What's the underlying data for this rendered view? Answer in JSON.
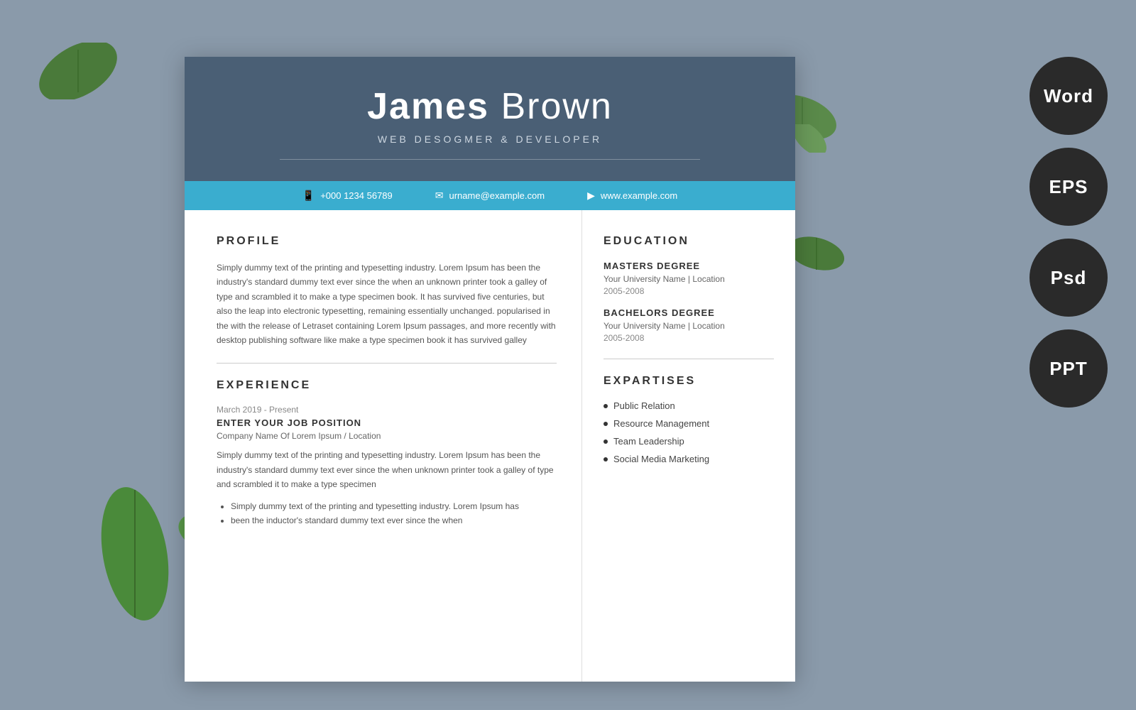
{
  "background_color": "#8a9aaa",
  "format_buttons": [
    {
      "id": "word",
      "label": "Word"
    },
    {
      "id": "eps",
      "label": "EPS"
    },
    {
      "id": "psd",
      "label": "Psd"
    },
    {
      "id": "ppt",
      "label": "PPT"
    }
  ],
  "resume": {
    "header": {
      "first_name": "James",
      "last_name": "Brown",
      "title": "WEB DESOGMER & DEVELOPER"
    },
    "contact": {
      "phone": "+000 1234 56789",
      "email": "urname@example.com",
      "website": "www.example.com"
    },
    "profile": {
      "section_title": "PROFILE",
      "text": "Simply dummy text of the printing and typesetting industry. Lorem Ipsum has been the industry's standard dummy text ever since the when an unknown printer took a galley of type and scrambled it to make a type specimen book. It has survived five centuries, but also the leap into electronic typesetting, remaining essentially unchanged. popularised in the with the release of Letraset containing Lorem Ipsum passages, and more recently with desktop publishing software like make a type specimen book it has survived galley"
    },
    "experience": {
      "section_title": "EXPERIENCE",
      "jobs": [
        {
          "date": "March 2019 - Present",
          "position": "ENTER YOUR JOB POSITION",
          "company": "Company Name Of Lorem Ipsum / Location",
          "description": "Simply dummy text of the printing and typesetting industry. Lorem Ipsum has been the industry's standard dummy text ever since the when unknown printer took a galley of type and scrambled it to make a type specimen",
          "bullets": [
            "Simply dummy text of the printing and typesetting industry. Lorem Ipsum has",
            "been the inductor's standard dummy text ever since the when"
          ]
        }
      ]
    },
    "education": {
      "section_title": "EDUCATION",
      "degrees": [
        {
          "degree": "MASTERS DEGREE",
          "school": "Your University Name | Location",
          "years": "2005-2008"
        },
        {
          "degree": "BACHELORS DEGREE",
          "school": "Your University Name | Location",
          "years": "2005-2008"
        }
      ]
    },
    "expertises": {
      "section_title": "EXPARTISES",
      "items": [
        "Public Relation",
        "Resource Management",
        "Team Leadership",
        "Social Media Marketing"
      ]
    }
  }
}
